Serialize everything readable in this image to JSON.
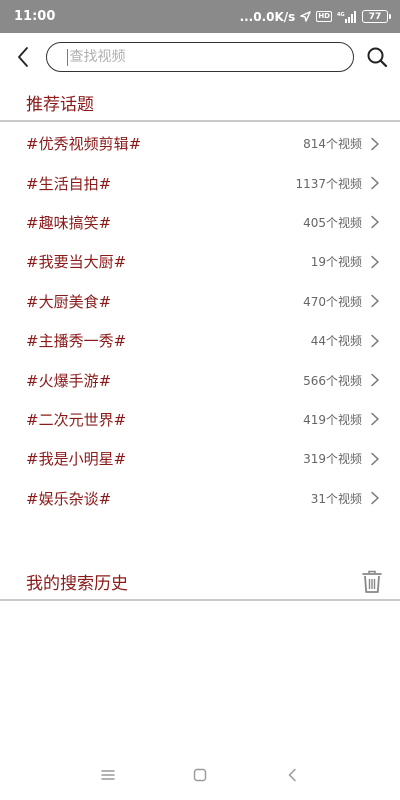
{
  "status_bar": {
    "time": "11:00",
    "speed": "...0.0K/s",
    "network": "4G",
    "hd": "HD",
    "battery": "77"
  },
  "search": {
    "placeholder": "查找视频",
    "value": ""
  },
  "recommended": {
    "title": "推荐话题",
    "topics": [
      {
        "name": "#优秀视频剪辑#",
        "count": "814个视频"
      },
      {
        "name": "#生活自拍#",
        "count": "1137个视频"
      },
      {
        "name": "#趣味搞笑#",
        "count": "405个视频"
      },
      {
        "name": "#我要当大厨#",
        "count": "19个视频"
      },
      {
        "name": "#大厨美食#",
        "count": "470个视频"
      },
      {
        "name": "#主播秀一秀#",
        "count": "44个视频"
      },
      {
        "name": "#火爆手游#",
        "count": "566个视频"
      },
      {
        "name": "#二次元世界#",
        "count": "419个视频"
      },
      {
        "name": "#我是小明星#",
        "count": "319个视频"
      },
      {
        "name": "#娱乐杂谈#",
        "count": "31个视频"
      }
    ]
  },
  "history": {
    "title": "我的搜索历史"
  },
  "icons": {
    "back": "chevron-left-icon",
    "search": "search-icon",
    "trash": "trash-icon",
    "nav_menu": "menu-icon",
    "nav_home": "home-square-icon",
    "nav_back": "nav-back-icon"
  },
  "colors": {
    "accent": "#8b1a1a",
    "status_bar": "#8a8a8a"
  }
}
